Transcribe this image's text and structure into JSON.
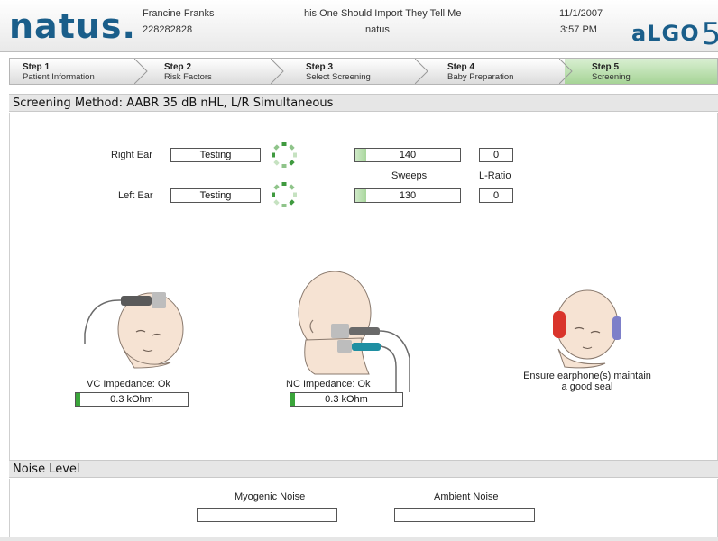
{
  "header": {
    "logo": "natus",
    "patient_name": "Francine Franks",
    "patient_id": "228282828",
    "title": "his One Should Import They Tell Me",
    "subtitle": "natus",
    "date": "11/1/2007",
    "time": "3:57 PM",
    "product_logo": "ALGO5"
  },
  "steps": [
    {
      "title": "Step 1",
      "label": "Patient Information",
      "active": false
    },
    {
      "title": "Step 2",
      "label": "Risk Factors",
      "active": false
    },
    {
      "title": "Step 3",
      "label": "Select Screening",
      "active": false
    },
    {
      "title": "Step 4",
      "label": "Baby Preparation",
      "active": false
    },
    {
      "title": "Step 5",
      "label": "Screening",
      "active": true
    }
  ],
  "screening": {
    "section_title": "Screening Method: AABR 35 dB nHL, L/R Simultaneous",
    "right_ear_label": "Right Ear",
    "right_ear_status": "Testing",
    "left_ear_label": "Left Ear",
    "left_ear_status": "Testing",
    "right_sweeps": "140",
    "left_sweeps": "130",
    "right_sweeps_progress": 0.1,
    "left_sweeps_progress": 0.1,
    "sweeps_label": "Sweeps",
    "lratio_label": "L-Ratio",
    "right_lratio": "0",
    "left_lratio": "0"
  },
  "impedance": {
    "vc_label": "VC Impedance:  Ok",
    "vc_value": "0.3 kOhm",
    "nc_label": "NC Impedance:  Ok",
    "nc_value": "0.3 kOhm",
    "earphone_note_line1": "Ensure earphone(s) maintain",
    "earphone_note_line2": "a good seal"
  },
  "noise": {
    "section_title": "Noise Level",
    "myogenic_label": "Myogenic Noise",
    "ambient_label": "Ambient Noise",
    "myogenic_value": "",
    "ambient_value": ""
  },
  "colors": {
    "brand": "#1a5e8a",
    "active_step": "#a6d496",
    "meter_fill": "#3aa53a",
    "spinner": "#3f9a3f"
  }
}
